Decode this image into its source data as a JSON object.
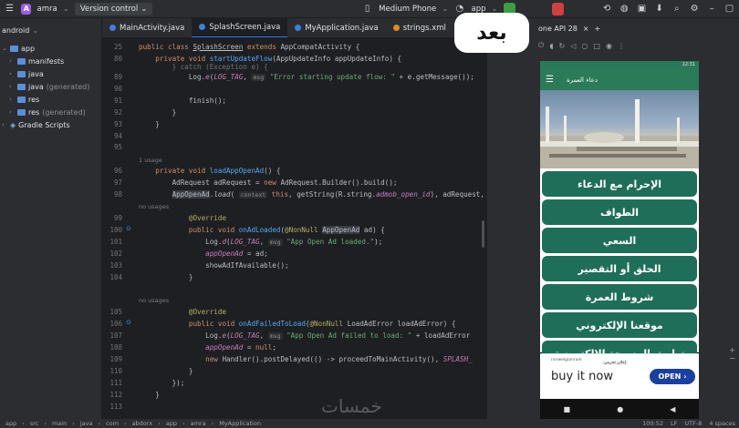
{
  "toolbar": {
    "project_initial": "A",
    "project_name": "amra",
    "vcs_label": "Version control",
    "device": "Medium Phone",
    "run_config": "app",
    "colors": {
      "run": "#3f9b46",
      "stop": "#d04040",
      "project": "#9b5de5"
    }
  },
  "project_tree": {
    "root": "android",
    "items": [
      {
        "label": "app",
        "sub": ""
      },
      {
        "label": "manifests",
        "sub": ""
      },
      {
        "label": "java",
        "sub": ""
      },
      {
        "label": "java",
        "sub": "(generated)"
      },
      {
        "label": "res",
        "sub": ""
      },
      {
        "label": "res",
        "sub": "(generated)"
      },
      {
        "label": "Gradle Scripts",
        "sub": ""
      }
    ]
  },
  "editor_tabs": [
    {
      "label": "MainActivity.java"
    },
    {
      "label": "SplashScreen.java"
    },
    {
      "label": "MyApplication.java"
    },
    {
      "label": "strings.xml"
    }
  ],
  "code": {
    "line_numbers": [
      "25",
      "80",
      "",
      "89",
      "90",
      "91",
      "92",
      "93",
      "94",
      "95",
      "",
      "96",
      "97",
      "98",
      "",
      "99",
      "100",
      "101",
      "102",
      "103",
      "104",
      "",
      "105",
      "106",
      "107",
      "108",
      "109",
      "110",
      "111",
      "112",
      "113",
      "114"
    ],
    "usage_1": "1 usage",
    "usage_2": "no usages",
    "usage_3": "no usages"
  },
  "devices": {
    "tab_label": "one API 28",
    "after_badge": "بعد"
  },
  "phone": {
    "status": "12:31",
    "title": "دعاء العمرة",
    "buttons": [
      "الإحرام مع الدعاء",
      "الطواف",
      "السعي",
      "الحلق أو التقصير",
      "شروط العمرة",
      "موقعنا الإلكتروني",
      "تطبيق المسبحة الإلكترونية"
    ],
    "ad_small": "norweigianrain",
    "ad_tag": "إعلان تجريبي",
    "ad_main": "buy it now",
    "ad_button": "OPEN"
  },
  "statusbar": {
    "crumbs": [
      "app",
      "src",
      "main",
      "java",
      "com",
      "abdorx",
      "app",
      "amra",
      "MyApplication"
    ],
    "position": "100:52",
    "line_sep": "LF",
    "encoding": "UTF-8",
    "indent": "4 spaces"
  },
  "watermark": "خمسات"
}
